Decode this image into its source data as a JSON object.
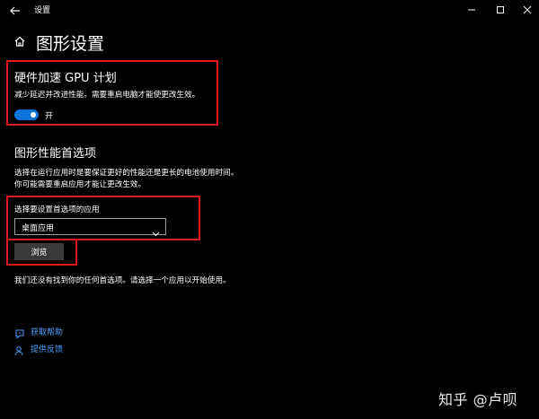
{
  "window": {
    "title": "设置"
  },
  "page": {
    "title": "图形设置"
  },
  "hardware_section": {
    "heading": "硬件加速 GPU 计划",
    "description": "减少延迟并改进性能。需要重启电脑才能使更改生效。",
    "toggle_state": "开",
    "toggle_on": true
  },
  "preference_section": {
    "heading": "图形性能首选项",
    "description_line1": "选择在运行应用时是要保证更好的性能还是更长的电池使用时间。",
    "description_line2": "你可能需要重启应用才能让更改生效。",
    "select_label": "选择要设置首选项的应用",
    "select_value": "桌面应用",
    "browse_label": "浏览",
    "empty_message": "我们还没有找到你的任何首选项。请选择一个应用以开始使用。"
  },
  "links": {
    "help": "获取帮助",
    "feedback": "提供反馈"
  },
  "watermark": "知乎 @卢呗",
  "colors": {
    "accent": "#0a74da",
    "link": "#4aa3ff",
    "highlight": "#e01919",
    "background": "#000000"
  }
}
